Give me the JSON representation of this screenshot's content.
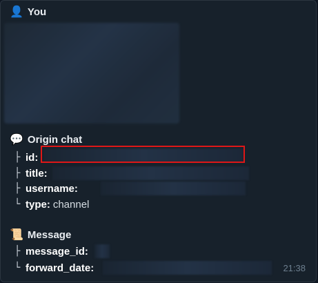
{
  "you": {
    "icon": "user-icon",
    "title": "You"
  },
  "origin_chat": {
    "icon": "speech-bubble-icon",
    "title": "Origin chat",
    "fields": [
      {
        "key": "id:",
        "value": ""
      },
      {
        "key": "title:",
        "value": ""
      },
      {
        "key": "username:",
        "value": ""
      },
      {
        "key": "type:",
        "value": "channel"
      }
    ]
  },
  "message": {
    "icon": "scroll-icon",
    "title": "Message",
    "fields": [
      {
        "key": "message_id:",
        "value": ""
      },
      {
        "key": "forward_date:",
        "value": ""
      }
    ]
  },
  "tree_glyphs": {
    "branch": "├",
    "last": "└"
  },
  "timestamp": "21:38",
  "colors": {
    "highlight": "#e01717",
    "background": "#17212b"
  }
}
